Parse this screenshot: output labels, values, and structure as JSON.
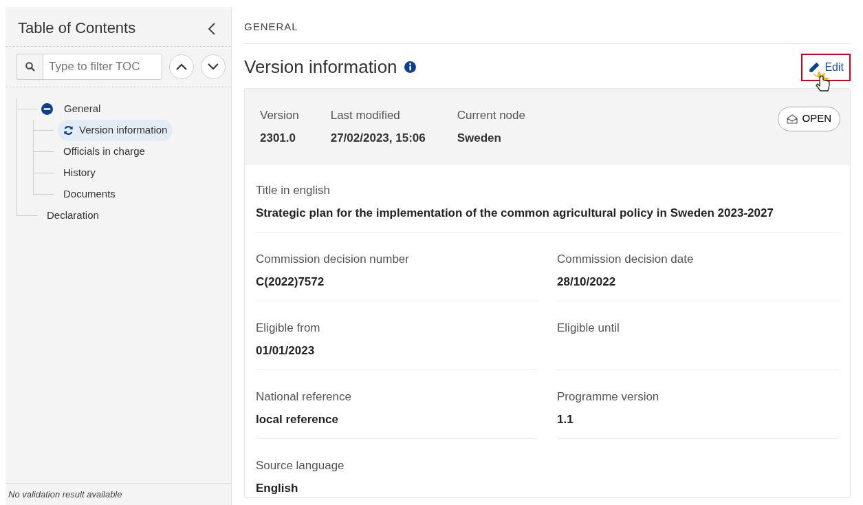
{
  "sidebar": {
    "title": "Table of Contents",
    "filter": {
      "placeholder": "Type to filter TOC"
    },
    "tree": [
      {
        "label": "General",
        "expanded": true,
        "selected": false,
        "children": [
          {
            "label": "Version information",
            "selected": true,
            "loading": true
          },
          {
            "label": "Officials in charge",
            "selected": false,
            "loading": false
          },
          {
            "label": "History",
            "selected": false,
            "loading": false
          },
          {
            "label": "Documents",
            "selected": false,
            "loading": false
          }
        ]
      },
      {
        "label": "Declaration",
        "selected": false
      }
    ],
    "footer": "No validation result available"
  },
  "main": {
    "breadcrumb": "GENERAL",
    "heading": "Version information",
    "edit_button": {
      "label": "Edit",
      "highlighted": true
    },
    "summary": [
      {
        "label": "Version",
        "value": "2301.0"
      },
      {
        "label": "Last modified",
        "value": "27/02/2023, 15:06"
      },
      {
        "label": "Current node",
        "value": "Sweden"
      }
    ],
    "status_button": "OPEN",
    "fields": [
      {
        "kind": "full",
        "label": "Title in english",
        "value": "Strategic plan for the implementation of the common agricultural policy in Sweden 2023-2027"
      },
      {
        "kind": "half",
        "label": "Commission decision number",
        "value": "C(2022)7572"
      },
      {
        "kind": "half",
        "label": "Commission decision date",
        "value": "28/10/2022"
      },
      {
        "kind": "half",
        "label": "Eligible from",
        "value": "01/01/2023"
      },
      {
        "kind": "half",
        "label": "Eligible until"
      },
      {
        "kind": "half",
        "label": "National reference",
        "value": "local reference"
      },
      {
        "kind": "half",
        "label": "Programme version",
        "value": "1.1"
      },
      {
        "kind": "half",
        "label": "Source language",
        "value": "English"
      }
    ]
  }
}
